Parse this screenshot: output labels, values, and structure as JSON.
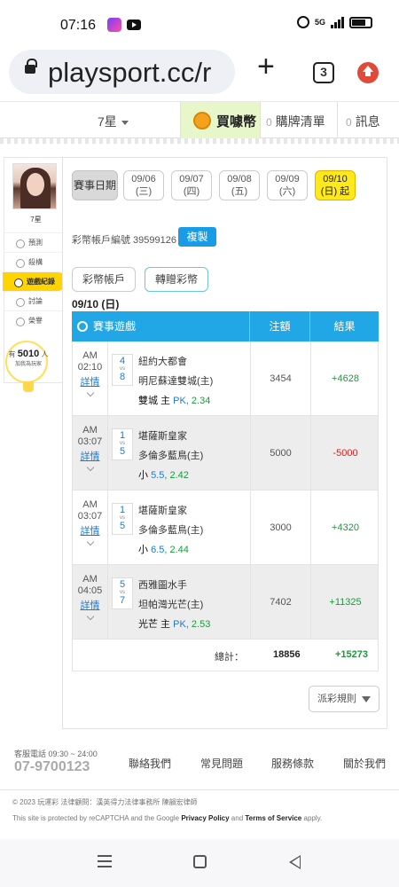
{
  "status_bar": {
    "time": "07:16",
    "network": "5G"
  },
  "browser": {
    "url": "playsport.cc/r",
    "tab_count": "3"
  },
  "site_nav": {
    "user": "7星",
    "buy_label": "買噱幣",
    "cart_count": "0",
    "cart_label": "購牌清單",
    "msg_count": "0",
    "msg_label": "訊息"
  },
  "sidebar": {
    "name": "7星",
    "items": [
      {
        "label": "預測"
      },
      {
        "label": "殺構"
      },
      {
        "label": "遊戲紀錄"
      },
      {
        "label": "討論"
      },
      {
        "label": "榮譽"
      }
    ],
    "bulb_prefix": "有",
    "bulb_count": "5010",
    "bulb_suffix": "人",
    "bulb_sub": "加我為玩家"
  },
  "dates": {
    "label": "賽事日期",
    "items": [
      {
        "date": "09/06",
        "day": "(三)"
      },
      {
        "date": "09/07",
        "day": "(四)"
      },
      {
        "date": "09/08",
        "day": "(五)"
      },
      {
        "date": "09/09",
        "day": "(六)"
      },
      {
        "date": "09/10",
        "day": "(日) 起"
      }
    ]
  },
  "account": {
    "label": "彩幣帳戶編號 39599126",
    "copy_label": "複製",
    "tab_account": "彩幣帳戶",
    "tab_transfer": "轉贈彩幣"
  },
  "day_title": "09/10 (日)",
  "table": {
    "headers": {
      "game": "賽事遊戲",
      "amount": "注額",
      "result": "結果"
    },
    "detail_label": "詳情",
    "vs": "vs",
    "rows": [
      {
        "ampm": "AM",
        "time": "02:10",
        "score_a": "4",
        "score_b": "8",
        "team_a": "紐約大都會",
        "team_b": "明尼蘇達雙城(主)",
        "bet_text": "雙城 主 ",
        "bet_type": "PK",
        "bet_odds": ", 2.34",
        "amount": "3454",
        "result": "+4628",
        "result_type": "win"
      },
      {
        "ampm": "AM",
        "time": "03:07",
        "score_a": "1",
        "score_b": "5",
        "team_a": "堪薩斯皇家",
        "team_b": "多倫多藍鳥(主)",
        "bet_text": "小 ",
        "bet_type": "5.5",
        "bet_odds": ", 2.42",
        "amount": "5000",
        "result": "-5000",
        "result_type": "lose"
      },
      {
        "ampm": "AM",
        "time": "03:07",
        "score_a": "1",
        "score_b": "5",
        "team_a": "堪薩斯皇家",
        "team_b": "多倫多藍鳥(主)",
        "bet_text": "小 ",
        "bet_type": "6.5",
        "bet_odds": ", 2.44",
        "amount": "3000",
        "result": "+4320",
        "result_type": "win"
      },
      {
        "ampm": "AM",
        "time": "04:05",
        "score_a": "5",
        "score_b": "7",
        "team_a": "西雅圖水手",
        "team_b": "坦帕灣光芒(主)",
        "bet_text": "光芒 主 ",
        "bet_type": "PK",
        "bet_odds": ", 2.53",
        "amount": "7402",
        "result": "+11325",
        "result_type": "win"
      }
    ],
    "total_label": "總計：",
    "total_amount": "18856",
    "total_result": "+15273"
  },
  "rule_label": "派彩規則",
  "footer": {
    "phone_label": "客服電話 09:30 ~ 24:00",
    "phone": "07-9700123",
    "links": [
      "聯絡我們",
      "常見問題",
      "服務條款",
      "關於我們"
    ],
    "copyright": "© 2023 玩運彩 法律顧問：漢英得力法律事務所 陳韻宏律師",
    "recaptcha_1": "This site is protected by reCAPTCHA and the Google ",
    "privacy": "Privacy Policy",
    "and": " and ",
    "terms": "Terms of Service",
    "apply": " apply."
  }
}
